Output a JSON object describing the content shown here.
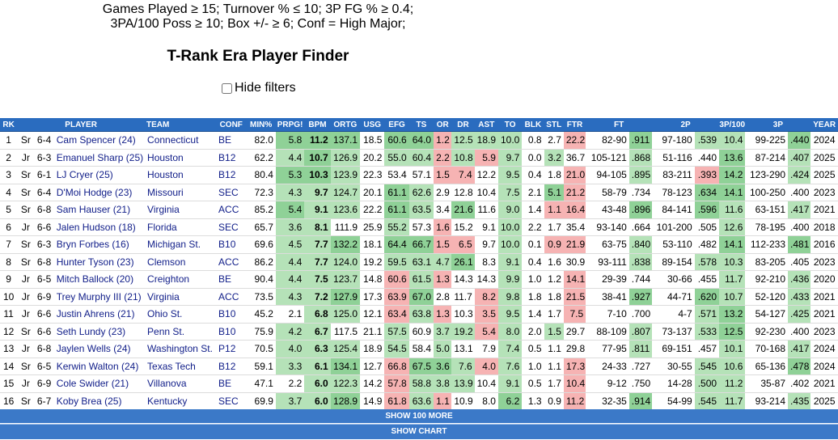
{
  "filters": {
    "line1": "Games Played ≥ 15; Turnover % ≤ 10; 3P FG % ≥ 0.4;",
    "line2": "3PA/100 Poss ≥ 10; Box +/- ≥ 6; Conf = High Major;"
  },
  "page_title": "T-Rank Era Player Finder",
  "hide_filters_label": "Hide filters",
  "columns": [
    "RK",
    "PLAYER",
    "TEAM",
    "CONF",
    "MIN%",
    "PRPG!",
    "BPM",
    "ORTG",
    "USG",
    "EFG",
    "TS",
    "OR",
    "DR",
    "AST",
    "TO",
    "BLK",
    "STL",
    "FTR",
    "FT",
    "",
    "2P",
    "",
    "3P/100",
    "3P",
    "",
    "YEAR"
  ],
  "rows": [
    [
      "1",
      "Sr",
      "6-4",
      "Cam Spencer (24)",
      "Connecticut",
      "BE",
      "82.0",
      "5.8",
      "11.2",
      "137.1",
      "18.5",
      "60.6",
      "64.0",
      "1.2",
      "12.5",
      "18.9",
      "10.0",
      "0.8",
      "2.7",
      "22.2",
      "82-90",
      ".911",
      "97-180",
      ".539",
      "10.4",
      "99-225",
      ".440",
      "2024"
    ],
    [
      "2",
      "Jr",
      "6-3",
      "Emanuel Sharp (25)",
      "Houston",
      "B12",
      "62.2",
      "4.4",
      "10.7",
      "126.9",
      "20.2",
      "55.0",
      "60.4",
      "2.2",
      "10.8",
      "5.9",
      "9.7",
      "0.0",
      "3.2",
      "36.7",
      "105-121",
      ".868",
      "51-116",
      ".440",
      "13.6",
      "87-214",
      ".407",
      "2025"
    ],
    [
      "3",
      "Sr",
      "6-1",
      "LJ Cryer (25)",
      "Houston",
      "B12",
      "80.4",
      "5.3",
      "10.3",
      "123.9",
      "22.3",
      "53.4",
      "57.1",
      "1.5",
      "7.4",
      "12.2",
      "9.5",
      "0.4",
      "1.8",
      "21.0",
      "94-105",
      ".895",
      "83-211",
      ".393",
      "14.2",
      "123-290",
      ".424",
      "2025"
    ],
    [
      "4",
      "Sr",
      "6-4",
      "D'Moi Hodge (23)",
      "Missouri",
      "SEC",
      "72.3",
      "4.3",
      "9.7",
      "124.7",
      "20.1",
      "61.1",
      "62.6",
      "2.9",
      "12.8",
      "10.4",
      "7.5",
      "2.1",
      "5.1",
      "21.2",
      "58-79",
      ".734",
      "78-123",
      ".634",
      "14.1",
      "100-250",
      ".400",
      "2023"
    ],
    [
      "5",
      "Sr",
      "6-8",
      "Sam Hauser (21)",
      "Virginia",
      "ACC",
      "85.2",
      "5.4",
      "9.1",
      "123.6",
      "22.2",
      "61.1",
      "63.5",
      "3.4",
      "21.6",
      "11.6",
      "9.0",
      "1.4",
      "1.1",
      "16.4",
      "43-48",
      ".896",
      "84-141",
      ".596",
      "11.6",
      "63-151",
      ".417",
      "2021"
    ],
    [
      "6",
      "Jr",
      "6-6",
      "Jalen Hudson (18)",
      "Florida",
      "SEC",
      "65.7",
      "3.6",
      "8.1",
      "111.9",
      "25.9",
      "55.2",
      "57.3",
      "1.6",
      "15.2",
      "9.1",
      "10.0",
      "2.2",
      "1.7",
      "35.4",
      "93-140",
      ".664",
      "101-200",
      ".505",
      "12.6",
      "78-195",
      ".400",
      "2018"
    ],
    [
      "7",
      "Sr",
      "6-3",
      "Bryn Forbes (16)",
      "Michigan St.",
      "B10",
      "69.6",
      "4.5",
      "7.7",
      "132.2",
      "18.1",
      "64.4",
      "66.7",
      "1.5",
      "6.5",
      "9.7",
      "10.0",
      "0.1",
      "0.9",
      "21.9",
      "63-75",
      ".840",
      "53-110",
      ".482",
      "14.1",
      "112-233",
      ".481",
      "2016"
    ],
    [
      "8",
      "Sr",
      "6-8",
      "Hunter Tyson (23)",
      "Clemson",
      "ACC",
      "86.2",
      "4.4",
      "7.7",
      "124.0",
      "19.2",
      "59.5",
      "63.1",
      "4.7",
      "26.1",
      "8.3",
      "9.1",
      "0.4",
      "1.6",
      "30.9",
      "93-111",
      ".838",
      "89-154",
      ".578",
      "10.3",
      "83-205",
      ".405",
      "2023"
    ],
    [
      "9",
      "Jr",
      "6-5",
      "Mitch Ballock (20)",
      "Creighton",
      "BE",
      "90.4",
      "4.4",
      "7.5",
      "123.7",
      "14.8",
      "60.6",
      "61.5",
      "1.3",
      "14.3",
      "14.3",
      "9.9",
      "1.0",
      "1.2",
      "14.1",
      "29-39",
      ".744",
      "30-66",
      ".455",
      "11.7",
      "92-210",
      ".436",
      "2020"
    ],
    [
      "10",
      "Jr",
      "6-9",
      "Trey Murphy III (21)",
      "Virginia",
      "ACC",
      "73.5",
      "4.3",
      "7.2",
      "127.9",
      "17.3",
      "63.9",
      "67.0",
      "2.8",
      "11.7",
      "8.2",
      "9.8",
      "1.8",
      "1.8",
      "21.5",
      "38-41",
      ".927",
      "44-71",
      ".620",
      "10.7",
      "52-120",
      ".433",
      "2021"
    ],
    [
      "11",
      "Jr",
      "6-6",
      "Justin Ahrens (21)",
      "Ohio St.",
      "B10",
      "45.2",
      "2.1",
      "6.8",
      "125.0",
      "12.1",
      "63.4",
      "63.8",
      "1.3",
      "10.3",
      "3.5",
      "9.5",
      "1.4",
      "1.7",
      "7.5",
      "7-10",
      ".700",
      "4-7",
      ".571",
      "13.2",
      "54-127",
      ".425",
      "2021"
    ],
    [
      "12",
      "Sr",
      "6-6",
      "Seth Lundy (23)",
      "Penn St.",
      "B10",
      "75.9",
      "4.2",
      "6.7",
      "117.5",
      "21.1",
      "57.5",
      "60.9",
      "3.7",
      "19.2",
      "5.4",
      "8.0",
      "2.0",
      "1.5",
      "29.7",
      "88-109",
      ".807",
      "73-137",
      ".533",
      "12.5",
      "92-230",
      ".400",
      "2023"
    ],
    [
      "13",
      "Jr",
      "6-8",
      "Jaylen Wells (24)",
      "Washington St.",
      "P12",
      "70.5",
      "4.0",
      "6.3",
      "125.4",
      "18.9",
      "54.5",
      "58.4",
      "5.0",
      "13.1",
      "7.9",
      "7.4",
      "0.5",
      "1.1",
      "29.8",
      "77-95",
      ".811",
      "69-151",
      ".457",
      "10.1",
      "70-168",
      ".417",
      "2024"
    ],
    [
      "14",
      "Sr",
      "6-5",
      "Kerwin Walton (24)",
      "Texas Tech",
      "B12",
      "59.1",
      "3.3",
      "6.1",
      "134.1",
      "12.7",
      "66.8",
      "67.5",
      "3.6",
      "7.6",
      "4.0",
      "7.6",
      "1.0",
      "1.1",
      "17.3",
      "24-33",
      ".727",
      "30-55",
      ".545",
      "10.6",
      "65-136",
      ".478",
      "2024"
    ],
    [
      "15",
      "Jr",
      "6-9",
      "Cole Swider (21)",
      "Villanova",
      "BE",
      "47.1",
      "2.2",
      "6.0",
      "122.3",
      "14.2",
      "57.8",
      "58.8",
      "3.8",
      "13.9",
      "10.4",
      "9.1",
      "0.5",
      "1.7",
      "10.4",
      "9-12",
      ".750",
      "14-28",
      ".500",
      "11.2",
      "35-87",
      ".402",
      "2021"
    ],
    [
      "16",
      "Sr",
      "6-7",
      "Koby Brea (25)",
      "Kentucky",
      "SEC",
      "69.9",
      "3.7",
      "6.0",
      "128.9",
      "14.9",
      "61.8",
      "63.6",
      "1.1",
      "10.9",
      "8.0",
      "6.2",
      "1.3",
      "0.9",
      "11.2",
      "32-35",
      ".914",
      "54-99",
      ".545",
      "11.7",
      "93-214",
      ".435",
      "2025"
    ]
  ],
  "shades": {
    "green_dark": "#8fd197",
    "green": "#b5e2b8",
    "green_light": "#d8efd9",
    "red": "#f6b3b3",
    "red_light": "#f9d3d3",
    "header": "#2a6cbf",
    "button": "#3b79c8"
  },
  "show_more_label": "SHOW 100 MORE",
  "show_chart_label": "SHOW CHART"
}
